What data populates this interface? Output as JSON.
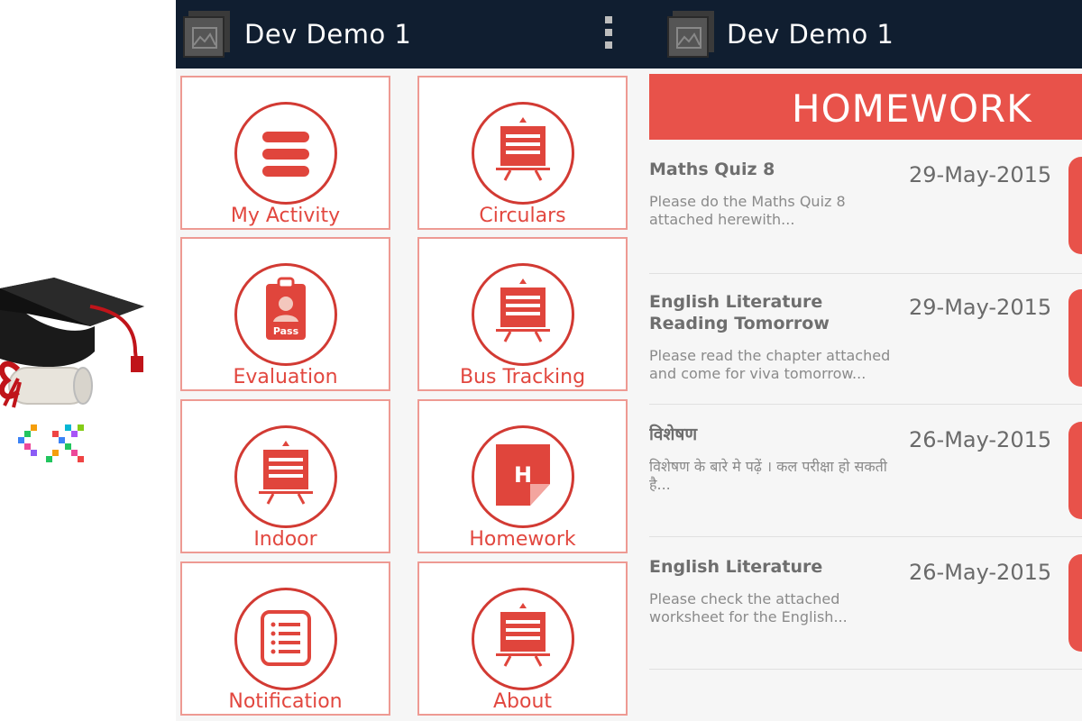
{
  "app": {
    "title": "Dev Demo 1"
  },
  "colors": {
    "appbar": "#101e30",
    "accent": "#e8524a",
    "tile_border": "#ee9a93",
    "icon_red": "#d23a33"
  },
  "brand": {
    "icon": "graduation-cap-logo"
  },
  "menu": {
    "tiles": [
      {
        "label": "My Activity",
        "icon": "hamburger-menu-icon"
      },
      {
        "label": "Circulars",
        "icon": "presentation-board-icon"
      },
      {
        "label": "Evaluation",
        "icon": "pass-badge-icon",
        "icon_text": "Pass"
      },
      {
        "label": "Bus Tracking",
        "icon": "presentation-board-icon"
      },
      {
        "label": "Indoor",
        "icon": "presentation-board-icon"
      },
      {
        "label": "Homework",
        "icon": "homework-note-icon",
        "icon_text": "H"
      },
      {
        "label": "Notification",
        "icon": "list-document-icon"
      },
      {
        "label": "About",
        "icon": "presentation-board-icon"
      }
    ]
  },
  "homework": {
    "heading": "HOMEWORK",
    "items": [
      {
        "title": "Maths Quiz 8",
        "description": "Please do the Maths Quiz 8 attached herewith...",
        "date": "29-May-2015"
      },
      {
        "title": "English Literature Reading Tomorrow",
        "description": "Please read the chapter attached and come for viva tomorrow...",
        "date": "29-May-2015"
      },
      {
        "title": "विशेषण",
        "description": "विशेषण के बारे मे पढ़ें । कल परीक्षा हो सकती है...",
        "date": "26-May-2015"
      },
      {
        "title": "English Literature",
        "description": "Please check the attached worksheet for the English...",
        "date": "26-May-2015"
      }
    ]
  }
}
